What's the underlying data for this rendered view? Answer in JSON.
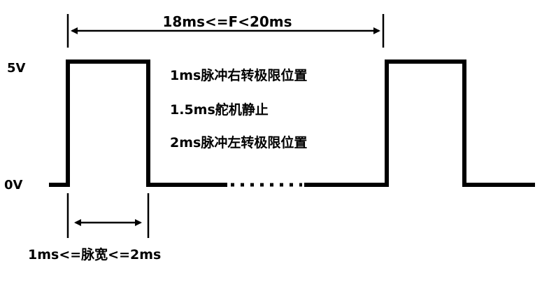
{
  "levels": {
    "high": "5V",
    "low": "0V"
  },
  "period_label": "18ms<=F<20ms",
  "pulse_width_label": "1ms<=脉宽<=2ms",
  "notes": [
    "1ms脉冲右转极限位置",
    "1.5ms舵机静止",
    "2ms脉冲左转极限位置"
  ],
  "colors": {
    "line": "#000000",
    "background": "#ffffff"
  }
}
